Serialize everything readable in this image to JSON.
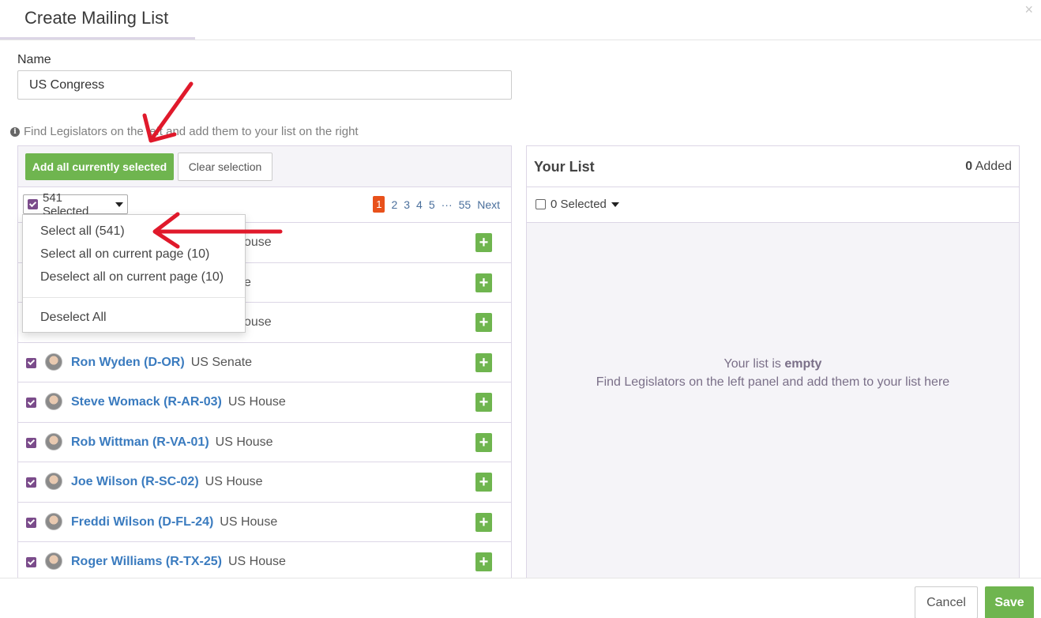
{
  "modal": {
    "title": "Create Mailing List",
    "close_glyph": "×"
  },
  "name_field": {
    "label": "Name",
    "value": "US Congress"
  },
  "hint": "Find Legislators on the left and add them to your list on the right",
  "left": {
    "add_all_label": "Add all currently selected",
    "clear_label": "Clear selection",
    "selected_label": "541 Selected",
    "pager": {
      "active": "1",
      "pages": [
        "2",
        "3",
        "4",
        "5"
      ],
      "dots": "···",
      "last": "55",
      "next": "Next"
    },
    "menu": {
      "select_all": "Select all (541)",
      "select_page": "Select all on current page (10)",
      "deselect_page": "Deselect all on current page (10)",
      "deselect_all": "Deselect All"
    },
    "hidden_rows": [
      {
        "chamber": "ouse"
      },
      {
        "chamber": "e"
      },
      {
        "chamber": "ouse"
      }
    ],
    "rows": [
      {
        "name": "Ron Wyden (D-OR)",
        "chamber": "US Senate"
      },
      {
        "name": "Steve Womack (R-AR-03)",
        "chamber": "US House"
      },
      {
        "name": "Rob Wittman (R-VA-01)",
        "chamber": "US House"
      },
      {
        "name": "Joe Wilson (R-SC-02)",
        "chamber": "US House"
      },
      {
        "name": "Freddi Wilson (D-FL-24)",
        "chamber": "US House"
      },
      {
        "name": "Roger Williams (R-TX-25)",
        "chamber": "US House"
      }
    ],
    "plus_glyph": "+"
  },
  "right": {
    "title": "Your List",
    "count": "0",
    "count_suffix": "Added",
    "selected_label": "0 Selected",
    "empty_prefix": "Your list is",
    "empty_bold": "empty",
    "empty_line2": "Find Legislators on the left panel and add them to your list here"
  },
  "footer": {
    "cancel": "Cancel",
    "save": "Save"
  },
  "colors": {
    "accent_green": "#6fb54f",
    "checkbox_purple": "#7b4c8b",
    "page_active": "#e8511b",
    "link_blue": "#3a7bbf",
    "annotation_red": "#e0192b"
  }
}
